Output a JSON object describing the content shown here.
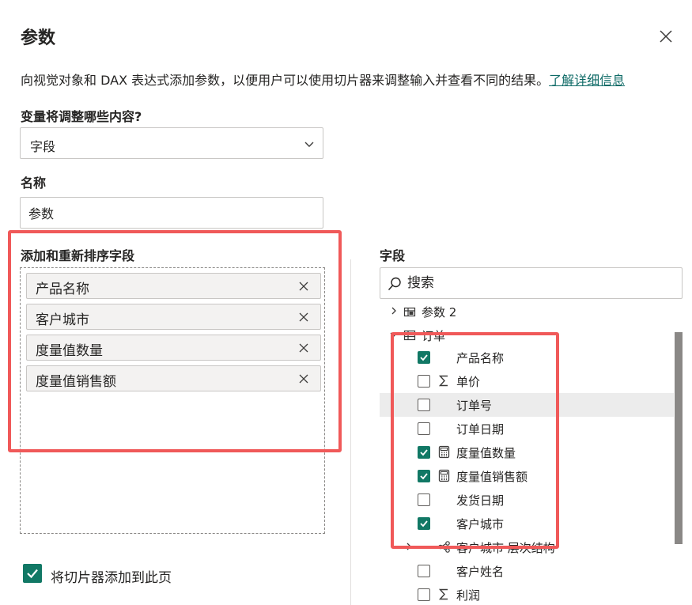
{
  "dialog": {
    "title": "参数",
    "description": "向视觉对象和 DAX 表达式添加参数，以便用户可以使用切片器来调整输入并查看不同的结果。",
    "learn_more": "了解详细信息"
  },
  "variable": {
    "label": "变量将调整哪些内容?",
    "selected": "字段"
  },
  "name": {
    "label": "名称",
    "value": "参数"
  },
  "reorder": {
    "label": "添加和重新排序字段",
    "chips": [
      "产品名称",
      "客户城市",
      "度量值数量",
      "度量值销售额"
    ]
  },
  "fields": {
    "label": "字段",
    "search_placeholder": "搜索",
    "tables": [
      {
        "name": "参数 2",
        "expanded": false
      },
      {
        "name": "订单",
        "expanded": true
      }
    ],
    "items": [
      {
        "label": "产品名称",
        "checked": true,
        "icon": "none"
      },
      {
        "label": "单价",
        "checked": false,
        "icon": "sigma-icon"
      },
      {
        "label": "订单号",
        "checked": false,
        "icon": "none",
        "hover": true
      },
      {
        "label": "订单日期",
        "checked": false,
        "icon": "none"
      },
      {
        "label": "度量值数量",
        "checked": true,
        "icon": "calculator-icon"
      },
      {
        "label": "度量值销售额",
        "checked": true,
        "icon": "calculator-icon"
      },
      {
        "label": "发货日期",
        "checked": false,
        "icon": "none"
      },
      {
        "label": "客户城市",
        "checked": true,
        "icon": "none"
      }
    ],
    "hierarchy": {
      "label": "客户城市 层次结构",
      "icon": "hierarchy-icon"
    },
    "more_items": [
      {
        "label": "客户姓名",
        "checked": false,
        "icon": "none"
      },
      {
        "label": "利润",
        "checked": false,
        "icon": "sigma-icon"
      }
    ]
  },
  "footer": {
    "add_slicer_label": "将切片器添加到此页",
    "add_slicer_checked": true
  },
  "colors": {
    "accent": "#117865",
    "link": "#0f6b67",
    "highlight": "#f05959"
  }
}
